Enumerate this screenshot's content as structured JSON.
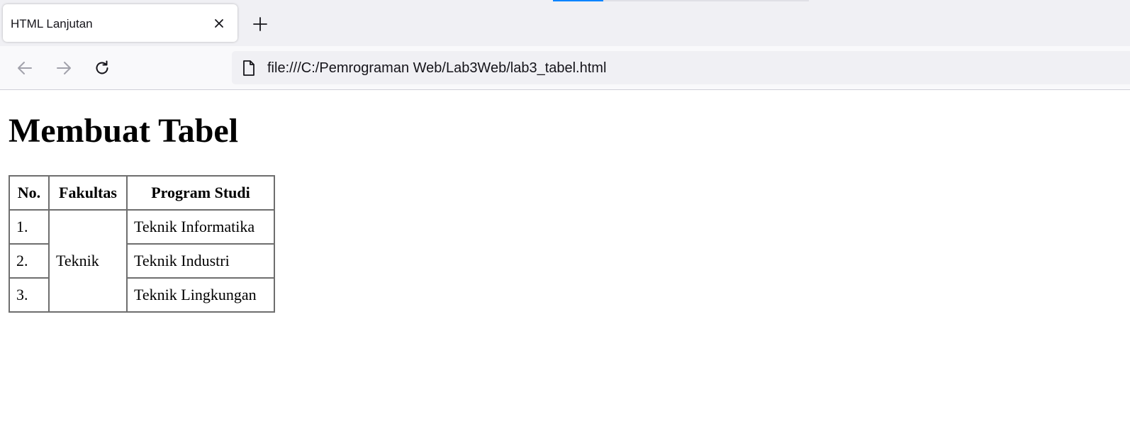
{
  "browser": {
    "tab": {
      "title": "HTML Lanjutan"
    },
    "address": {
      "url": "file:///C:/Pemrograman Web/Lab3Web/lab3_tabel.html"
    },
    "icons": {
      "close": "close-icon",
      "new_tab": "plus-icon",
      "back": "arrow-left-icon",
      "forward": "arrow-right-icon",
      "reload": "reload-icon",
      "page": "document-icon"
    },
    "colors": {
      "accent": "#0a84ff",
      "tabstrip": "#f0f0f4",
      "toolbar": "#f9f9fb"
    }
  },
  "page": {
    "title": "Membuat Tabel",
    "table": {
      "headers": [
        "No.",
        "Fakultas",
        "Program Studi"
      ],
      "fakultas": "Teknik",
      "rows": [
        {
          "no": "1.",
          "prodi": "Teknik Informatika"
        },
        {
          "no": "2.",
          "prodi": "Teknik Industri"
        },
        {
          "no": "3.",
          "prodi": "Teknik Lingkungan"
        }
      ]
    }
  }
}
